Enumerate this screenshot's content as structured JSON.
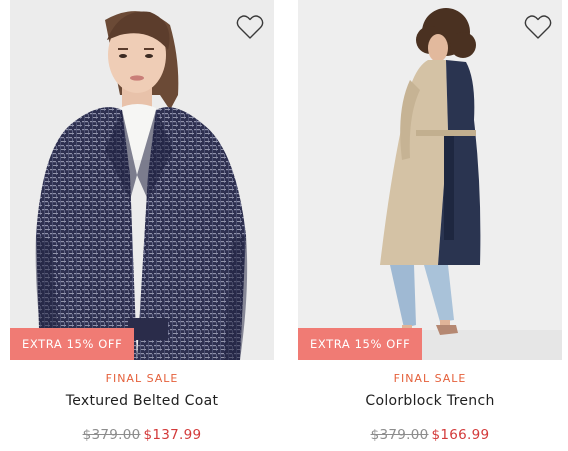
{
  "products": [
    {
      "badge": "EXTRA 15% OFF",
      "sale_tag": "FINAL SALE",
      "name": "Textured Belted Coat",
      "original_price": "$379.00",
      "sale_price": "$137.99",
      "wishlist_icon": "heart-outline-icon"
    },
    {
      "badge": "EXTRA 15% OFF",
      "sale_tag": "FINAL SALE",
      "name": "Colorblock Trench",
      "original_price": "$379.00",
      "sale_price": "$166.99",
      "wishlist_icon": "heart-outline-icon"
    }
  ],
  "colors": {
    "badge_bg": "#f07b74",
    "sale_tag": "#e5603b",
    "sale_price": "#d33a3a",
    "original_price": "#8d8d8d",
    "product_name": "#1f1f1f"
  }
}
